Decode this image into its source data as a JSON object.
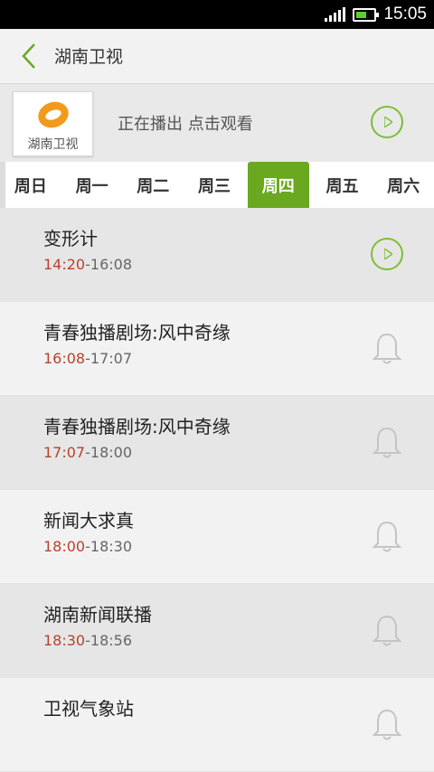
{
  "status_bar": {
    "time": "15:05",
    "battery_level": 0.6
  },
  "header": {
    "title": "湖南卫视"
  },
  "channel": {
    "logo_text": "湖南卫视",
    "now_playing": "正在播出 点击观看"
  },
  "tabs": [
    {
      "label": "周日",
      "active": false
    },
    {
      "label": "周一",
      "active": false
    },
    {
      "label": "周二",
      "active": false
    },
    {
      "label": "周三",
      "active": false
    },
    {
      "label": "周四",
      "active": true
    },
    {
      "label": "周五",
      "active": false
    },
    {
      "label": "周六",
      "active": false
    }
  ],
  "programs": [
    {
      "name": "变形计",
      "start": "14:20",
      "end": "16:08",
      "icon": "play-icon"
    },
    {
      "name": "青春独播剧场:风中奇缘",
      "start": "16:08",
      "end": "17:07",
      "icon": "bell-icon"
    },
    {
      "name": "青春独播剧场:风中奇缘",
      "start": "17:07",
      "end": "18:00",
      "icon": "bell-icon"
    },
    {
      "name": "新闻大求真",
      "start": "18:00",
      "end": "18:30",
      "icon": "bell-icon"
    },
    {
      "name": "湖南新闻联播",
      "start": "18:30",
      "end": "18:56",
      "icon": "bell-icon"
    },
    {
      "name": "卫视气象站",
      "start": "",
      "end": "",
      "icon": "bell-icon"
    }
  ],
  "colors": {
    "accent": "#6aa81f",
    "start_time": "#b7422c",
    "play_ring": "#7cbf35"
  }
}
